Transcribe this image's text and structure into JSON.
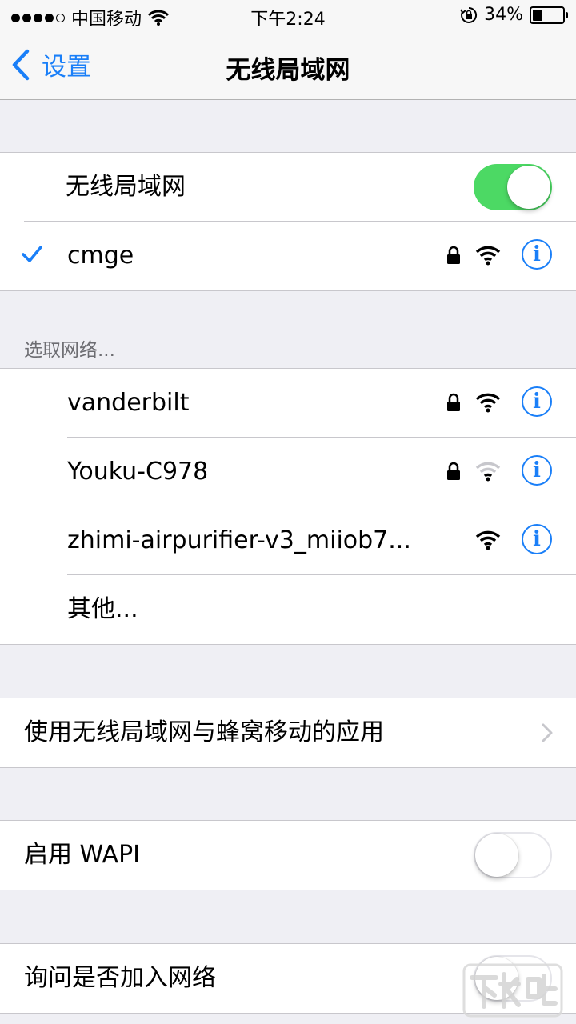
{
  "status_bar": {
    "carrier": "中国移动",
    "time": "下午2:24",
    "battery": "34%",
    "battery_level": 0.34,
    "signal_bars_filled": 4,
    "signal_bars_total": 5
  },
  "nav": {
    "back_label": "设置",
    "title": "无线局域网"
  },
  "wifi_toggle": {
    "label": "无线局域网",
    "on": true
  },
  "connected_network": {
    "name": "cmge",
    "secured": true
  },
  "choose_network": {
    "header": "选取网络...",
    "networks": [
      {
        "name": "vanderbilt",
        "secured": true,
        "signal": 3
      },
      {
        "name": "Youku-C978",
        "secured": true,
        "signal": 1
      },
      {
        "name": "zhimi-airpurifier-v3_miiob7...",
        "secured": false,
        "signal": 3
      }
    ],
    "other_label": "其他..."
  },
  "apps_row": {
    "label": "使用无线局域网与蜂窝移动的应用"
  },
  "wapi": {
    "label": "启用 WAPI",
    "on": false
  },
  "ask_join": {
    "label": "询问是否加入网络",
    "on": false
  },
  "colors": {
    "accent": "#1a7ff8",
    "switch_on": "#4cd964",
    "background": "#efeff4"
  },
  "watermark": {
    "text": "下载吧"
  }
}
